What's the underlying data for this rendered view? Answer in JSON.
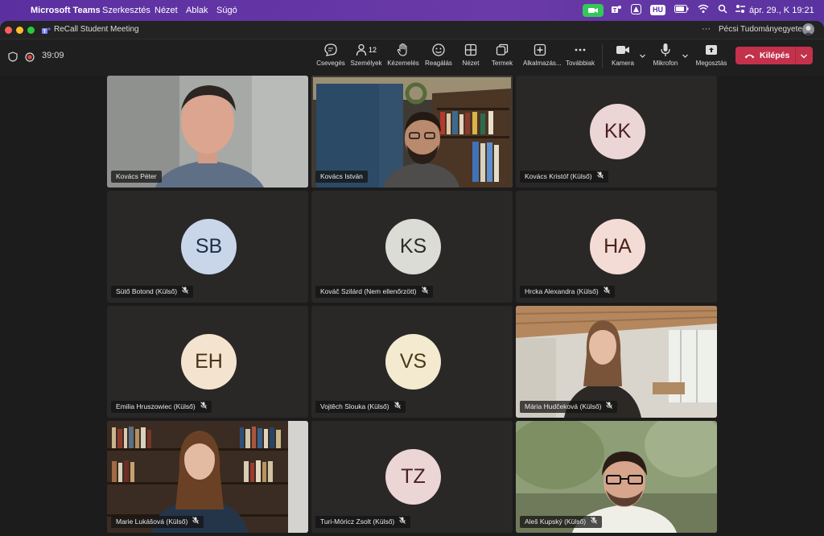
{
  "menubar": {
    "app_name": "Microsoft Teams",
    "items": [
      "Szerkesztés",
      "Nézet",
      "Ablak",
      "Súgó"
    ],
    "lang": "HU",
    "datetime": "ápr. 29., K  19:21"
  },
  "window": {
    "title": "ReCall Student Meeting",
    "org": "Pécsi Tudományegyetem",
    "more": "···"
  },
  "toolbar": {
    "timer": "39:09",
    "people_count": "12",
    "items": [
      {
        "label": "Csevegés",
        "icon": "chat-icon"
      },
      {
        "label": "Személyek",
        "icon": "people-icon"
      },
      {
        "label": "Kézemelés",
        "icon": "raise-hand-icon"
      },
      {
        "label": "Reagálás",
        "icon": "smile-icon"
      },
      {
        "label": "Nézet",
        "icon": "view-icon"
      },
      {
        "label": "Termek",
        "icon": "rooms-icon"
      },
      {
        "label": "Alkalmazás...",
        "icon": "apps-icon"
      },
      {
        "label": "Továbbiak",
        "icon": "more-icon"
      },
      {
        "label": "Kamera",
        "icon": "camera-icon"
      },
      {
        "label": "Mikrofon",
        "icon": "mic-icon"
      },
      {
        "label": "Megosztás",
        "icon": "share-icon"
      }
    ],
    "leave_label": "Kilépés"
  },
  "participants": [
    {
      "name": "Kovács Péter",
      "video": true
    },
    {
      "name": "Kovács István",
      "video": true,
      "active": true
    },
    {
      "name": "Kovács Kristóf (Külső)",
      "initials": "KK",
      "bg": "#ecd5d5",
      "fg": "#4a2020",
      "muted": true
    },
    {
      "name": "Sütő Botond (Külső)",
      "initials": "SB",
      "bg": "#c9d6ea",
      "fg": "#1f2e4a",
      "muted": true
    },
    {
      "name": "Kováč Szilárd (Nem ellenőrzött)",
      "initials": "KS",
      "bg": "#dcdcd6",
      "fg": "#2b2b2b",
      "muted": true
    },
    {
      "name": "Hrcka Alexandra (Külső)",
      "initials": "HA",
      "bg": "#f3dcd6",
      "fg": "#4a2418",
      "muted": true
    },
    {
      "name": "Emilia Hruszowiec (Külső)",
      "initials": "EH",
      "bg": "#f4e4cf",
      "fg": "#4a3218",
      "muted": true
    },
    {
      "name": "Vojtěch Slouka (Külső)",
      "initials": "VS",
      "bg": "#f3ead0",
      "fg": "#4a3a18",
      "muted": true
    },
    {
      "name": "Mária Hudčeková (Külső)",
      "video": true,
      "muted": true
    },
    {
      "name": "Marie Lukášová (Külső)",
      "video": true,
      "muted": true
    },
    {
      "name": "Turi-Móricz Zsolt (Külső)",
      "initials": "TZ",
      "bg": "#ecd5d5",
      "fg": "#4a2020",
      "muted": true
    },
    {
      "name": "Aleš Kupský (Külső)",
      "video": true,
      "muted": true
    }
  ],
  "colors": {
    "accent": "#7f85f5",
    "leave": "#c4314b",
    "camera_green": "#34c759"
  }
}
